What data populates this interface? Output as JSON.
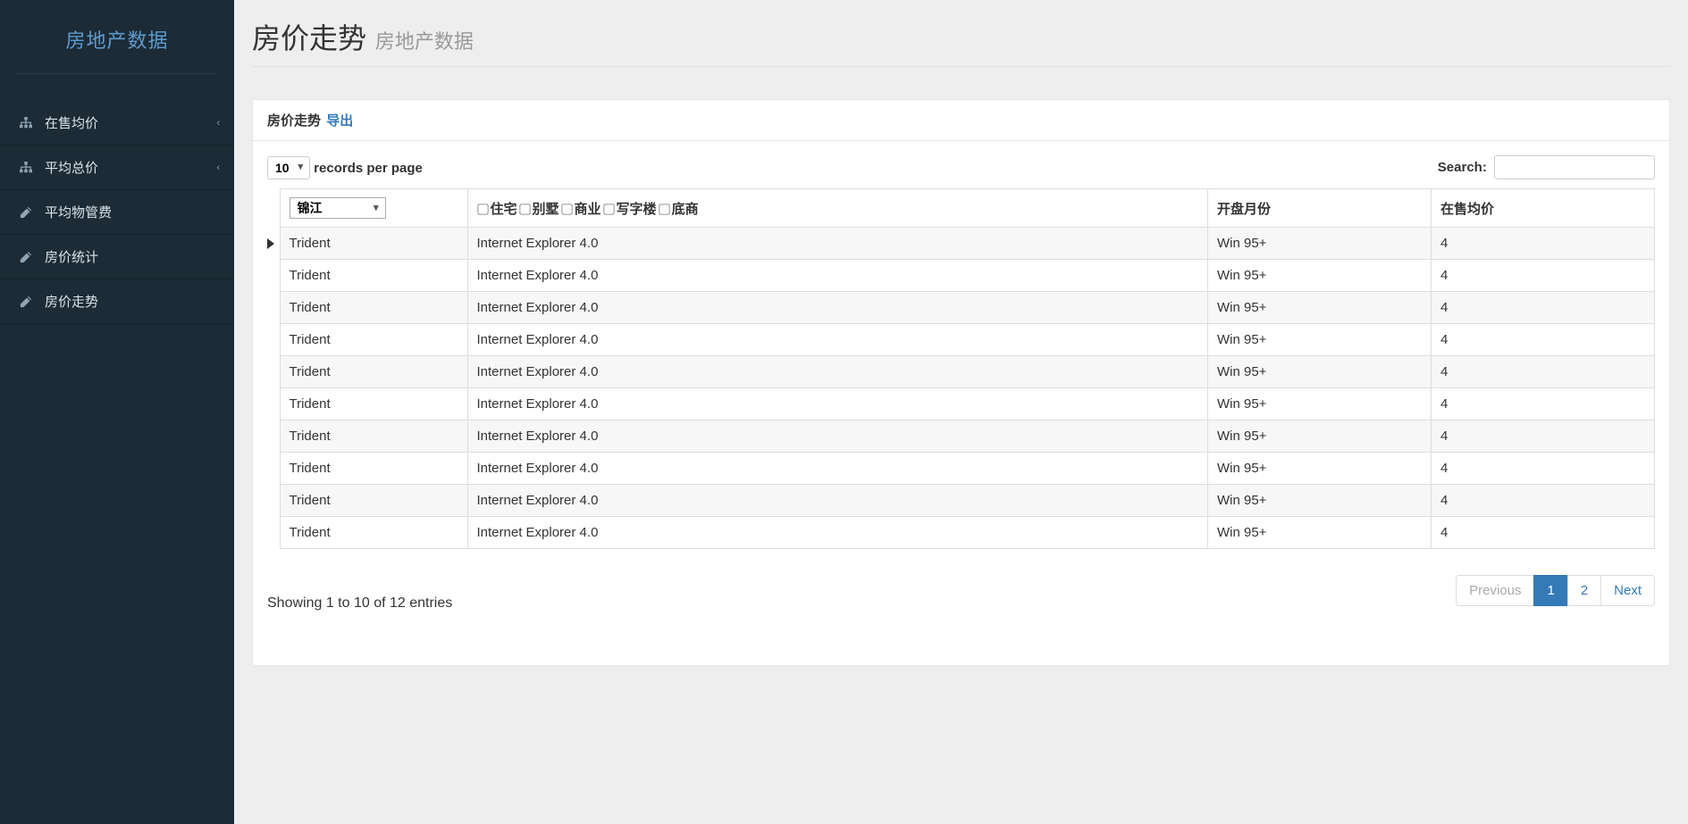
{
  "brand": "房地产数据",
  "sidebar": {
    "items": [
      {
        "label": "在售均价",
        "expandable": true
      },
      {
        "label": "平均总价",
        "expandable": true
      },
      {
        "label": "平均物管费",
        "expandable": false
      },
      {
        "label": "房价统计",
        "expandable": false
      },
      {
        "label": "房价走势",
        "expandable": false
      }
    ]
  },
  "header": {
    "title": "房价走势",
    "subtitle": "房地产数据"
  },
  "panel": {
    "title": "房价走势",
    "export_label": "导出"
  },
  "controls": {
    "page_size": "10",
    "records_per_page": "records per page",
    "search_label": "Search:",
    "district": "锦江",
    "type_options": [
      "住宅",
      "别墅",
      "商业",
      "写字楼",
      "底商"
    ],
    "col_month": "开盘月份",
    "col_price": "在售均价"
  },
  "rows": [
    {
      "c0": "Trident",
      "c1": "Internet Explorer 4.0",
      "c2": "Win 95+",
      "c3": "4"
    },
    {
      "c0": "Trident",
      "c1": "Internet Explorer 4.0",
      "c2": "Win 95+",
      "c3": "4"
    },
    {
      "c0": "Trident",
      "c1": "Internet Explorer 4.0",
      "c2": "Win 95+",
      "c3": "4"
    },
    {
      "c0": "Trident",
      "c1": "Internet Explorer 4.0",
      "c2": "Win 95+",
      "c3": "4"
    },
    {
      "c0": "Trident",
      "c1": "Internet Explorer 4.0",
      "c2": "Win 95+",
      "c3": "4"
    },
    {
      "c0": "Trident",
      "c1": "Internet Explorer 4.0",
      "c2": "Win 95+",
      "c3": "4"
    },
    {
      "c0": "Trident",
      "c1": "Internet Explorer 4.0",
      "c2": "Win 95+",
      "c3": "4"
    },
    {
      "c0": "Trident",
      "c1": "Internet Explorer 4.0",
      "c2": "Win 95+",
      "c3": "4"
    },
    {
      "c0": "Trident",
      "c1": "Internet Explorer 4.0",
      "c2": "Win 95+",
      "c3": "4"
    },
    {
      "c0": "Trident",
      "c1": "Internet Explorer 4.0",
      "c2": "Win 95+",
      "c3": "4"
    }
  ],
  "info": "Showing 1 to 10 of 12 entries",
  "pagination": {
    "prev": "Previous",
    "pages": [
      "1",
      "2"
    ],
    "active": 0,
    "next": "Next"
  }
}
